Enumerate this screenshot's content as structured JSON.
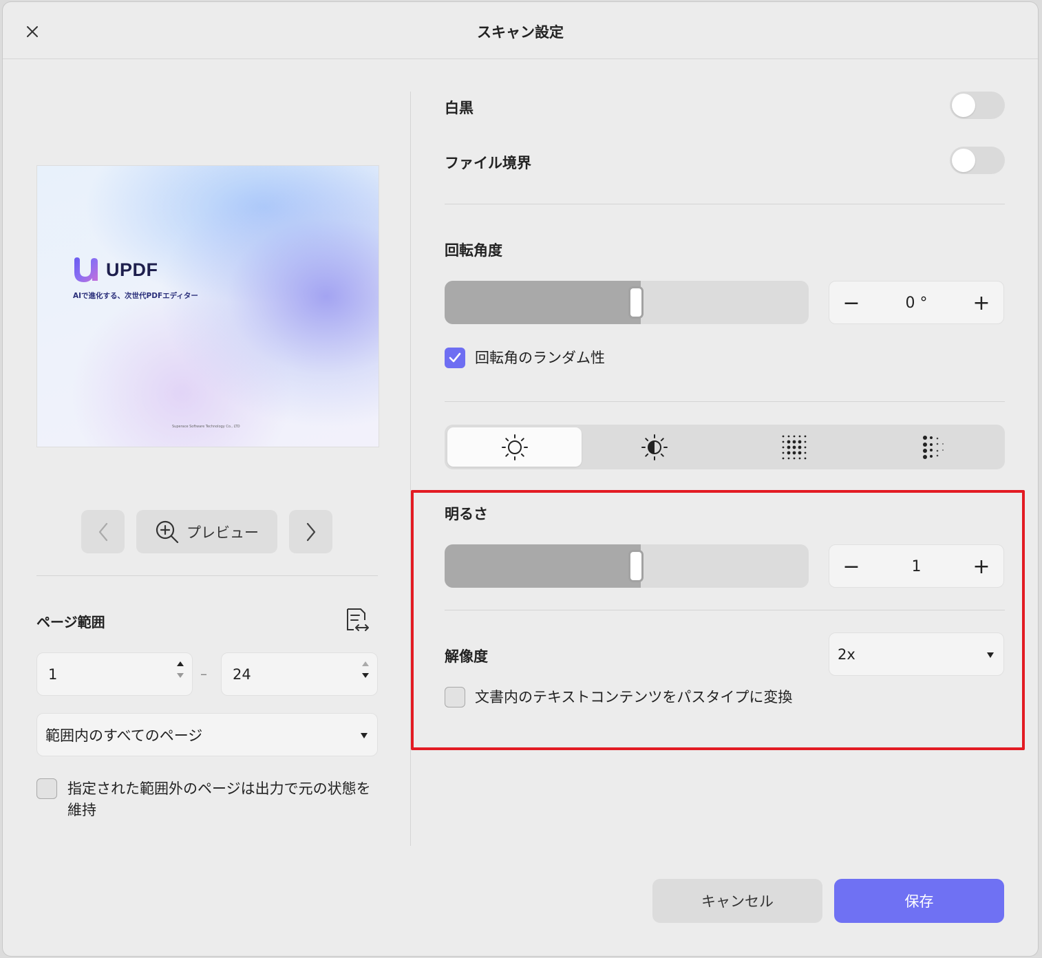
{
  "dialog": {
    "title": "スキャン設定",
    "close_icon": "close-icon"
  },
  "preview": {
    "logo_text": "UPDF",
    "tagline": "AIで進化する、次世代PDFエディター",
    "footer": "Superace Software Technology Co., LTD",
    "preview_button_label": "プレビュー"
  },
  "page_range": {
    "label": "ページ範囲",
    "from_value": "1",
    "separator": "–",
    "to_value": "24",
    "subset_selected": "範囲内のすべてのページ",
    "keep_outside_label": "指定された範囲外のページは出力で元の状態を維持",
    "keep_outside_checked": false
  },
  "settings": {
    "bw_label": "白黒",
    "bw_on": false,
    "border_label": "ファイル境界",
    "border_on": false,
    "rotation_label": "回転角度",
    "rotation_value": "0 °",
    "rotation_level": 0.5,
    "random_rotation_label": "回転角のランダム性",
    "random_rotation_checked": true,
    "tabs": [
      "brightness-icon",
      "contrast-icon",
      "dot-grid-icon",
      "scatter-dots-icon"
    ],
    "active_tab": 0,
    "brightness_label": "明るさ",
    "brightness_value": "1",
    "brightness_level": 0.5,
    "resolution_label": "解像度",
    "resolution_selected": "2x",
    "convert_text_label": "文書内のテキストコンテンツをパスタイプに変換",
    "convert_text_checked": false
  },
  "footer": {
    "cancel_label": "キャンセル",
    "save_label": "保存"
  },
  "colors": {
    "accent": "#6f71f3",
    "highlight": "#e21b23"
  }
}
